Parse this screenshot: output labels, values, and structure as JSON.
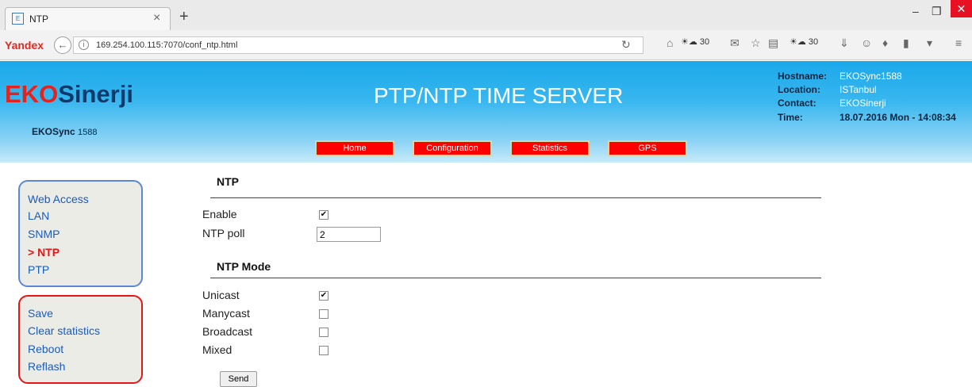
{
  "browser": {
    "tab_title": "NTP",
    "tab_close": "×",
    "new_tab": "+",
    "logo": "Yandex",
    "url": "169.254.100.115:7070/conf_ntp.html",
    "weather_temp_1": "30",
    "weather_temp_2": "30"
  },
  "header": {
    "brand_eko": "EKO",
    "brand_sinerji": "Sinerji",
    "device_name": "EKOSync",
    "device_model": "1588",
    "title": "PTP/NTP TIME SERVER",
    "info": {
      "hostname_label": "Hostname:",
      "hostname": "EKOSync1588",
      "location_label": "Location:",
      "location": "ISTanbul",
      "contact_label": "Contact:",
      "contact": "EKOSinerji",
      "time_label": "Time:",
      "time": "18.07.2016 Mon - 14:08:34"
    },
    "nav": [
      "Home",
      "Configuration",
      "Statistics",
      "GPS"
    ]
  },
  "sidebar": {
    "nav_items": [
      "Web Access",
      "LAN",
      "SNMP",
      "> NTP",
      "PTP"
    ],
    "action_items": [
      "Save",
      "Clear statistics",
      "Reboot",
      "Reflash"
    ]
  },
  "main": {
    "ntp_section_title": "NTP",
    "enable_label": "Enable",
    "enable_checked": true,
    "ntp_poll_label": "NTP poll",
    "ntp_poll_value": "2",
    "mode_section_title": "NTP Mode",
    "modes": [
      {
        "label": "Unicast",
        "checked": true
      },
      {
        "label": "Manycast",
        "checked": false
      },
      {
        "label": "Broadcast",
        "checked": false
      },
      {
        "label": "Mixed",
        "checked": false
      }
    ],
    "send_label": "Send"
  },
  "colors": {
    "accent_red": "#ff0000",
    "header_blue": "#1aa8ea",
    "link_blue": "#1a5bbd"
  }
}
